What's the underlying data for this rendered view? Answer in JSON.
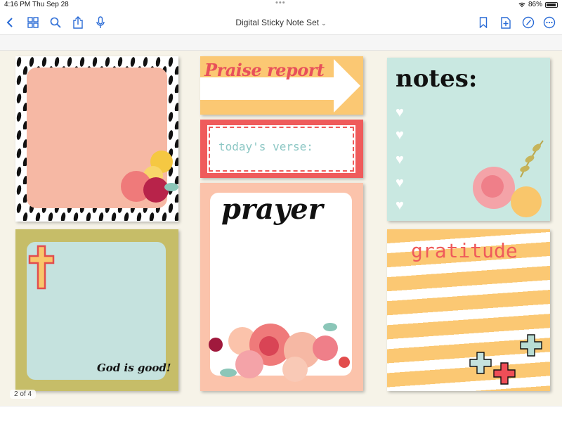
{
  "status_bar": {
    "time": "4:16 PM",
    "date": "Thu Sep 28",
    "battery": "86%"
  },
  "toolbar": {
    "title": "Digital Sticky Note Set",
    "icons": [
      "back-icon",
      "grid-icon",
      "search-icon",
      "share-icon",
      "microphone-icon",
      "bookmark-icon",
      "add-page-icon",
      "markup-icon"
    ],
    "accent": "#2a6bd6"
  },
  "notes": {
    "praise": {
      "title": "Praise report"
    },
    "verse": {
      "label": "today's verse:"
    },
    "notes": {
      "title": "notes:"
    },
    "cross": {
      "caption": "God is good!"
    },
    "prayer": {
      "title": "prayer"
    },
    "gratitude": {
      "title": "gratitude"
    }
  },
  "page_indicator": "2 of 4",
  "colors": {
    "peach": "#f6b8a4",
    "yellow": "#fbc873",
    "coral": "#ef5b5b",
    "mint": "#c9e8e1",
    "olive": "#c6bd68"
  }
}
